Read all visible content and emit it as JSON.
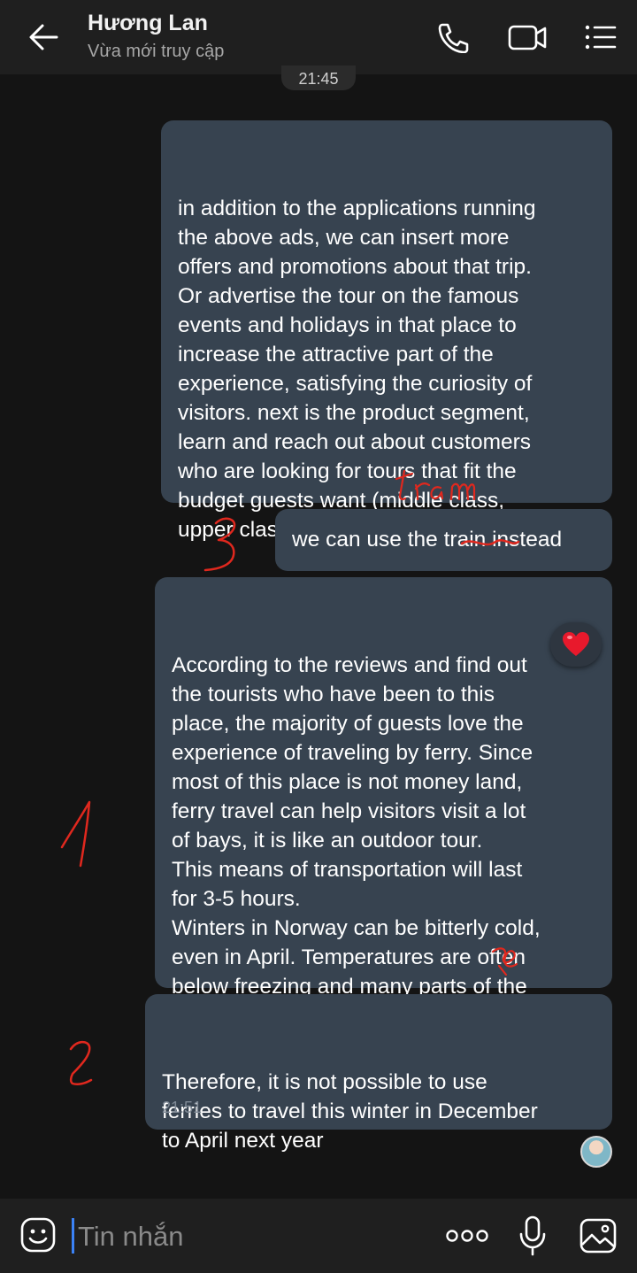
{
  "header": {
    "contact_name": "Hương Lan",
    "status": "Vừa mới truy cập",
    "icons": [
      "arrow-left-icon",
      "phone-icon",
      "video-camera-icon",
      "menu-list-icon"
    ]
  },
  "conversation": {
    "time_separator": "21:45",
    "messages": [
      {
        "text": "in addition to the applications running\nthe above ads, we can insert more\noffers and promotions about that trip.\nOr advertise the tour on the famous\nevents and holidays in that place to\nincrease the attractive part of the\nexperience, satisfying the curiosity of\nvisitors. next is the product segment,\nlearn and reach out about customers\nwho are looking for tours that fit the\nbudget guests want (middle class,\nupper class,..)"
      },
      {
        "text_before": "we can use the ",
        "struck_word": "train",
        "text_after": " instead"
      },
      {
        "text": "According to the reviews and find out\nthe tourists who have been to this\nplace, the majority of guests love the\nexperience of traveling by ferry. Since\nmost of this place is not money land,\nferry travel can help visitors visit a lot\nof bays, it is like an outdoor tour.\nThis means of transportation will last\nfor 3-5 hours.\nWinters in Norway can be bitterly cold,\neven in April. Temperatures are often\nbelow freezing and many parts of the\ncountry are covered in snow. So",
        "reaction": "heart"
      },
      {
        "text": "Therefore, it is not possible to use\nferries to travel this winter in December\nto April next year",
        "time": "21:51"
      }
    ],
    "handwritten_annotations": {
      "correction": "tram",
      "numbers": [
        "3",
        "1",
        "2"
      ],
      "color": "#e0281e"
    }
  },
  "composer": {
    "placeholder": "Tin nhắn"
  },
  "colors": {
    "background": "#141414",
    "bar": "#1f1f1f",
    "bubble": "#374350",
    "annotation_red": "#e0281e"
  }
}
